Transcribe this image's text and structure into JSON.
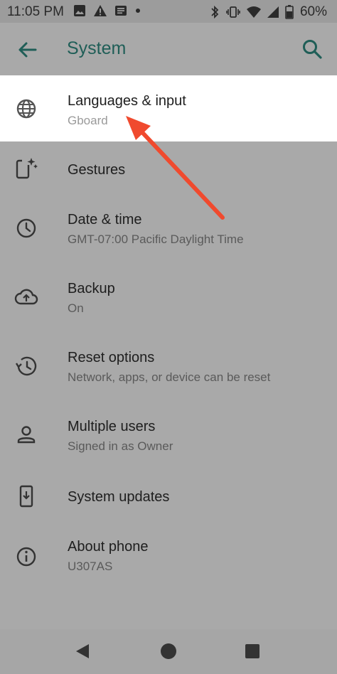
{
  "status_bar": {
    "time": "11:05 PM",
    "battery": "60%"
  },
  "app_bar": {
    "title": "System"
  },
  "items": [
    {
      "title": "Languages & input",
      "subtitle": "Gboard"
    },
    {
      "title": "Gestures",
      "subtitle": ""
    },
    {
      "title": "Date & time",
      "subtitle": "GMT-07:00 Pacific Daylight Time"
    },
    {
      "title": "Backup",
      "subtitle": "On"
    },
    {
      "title": "Reset options",
      "subtitle": "Network, apps, or device can be reset"
    },
    {
      "title": "Multiple users",
      "subtitle": "Signed in as Owner"
    },
    {
      "title": "System updates",
      "subtitle": ""
    },
    {
      "title": "About phone",
      "subtitle": "U307AS"
    }
  ],
  "colors": {
    "accent": "#1f5e57",
    "annotation_arrow": "#f04a2e"
  },
  "icons": [
    "back-arrow-icon",
    "search-icon",
    "globe-icon",
    "gestures-icon",
    "clock-icon",
    "backup-icon",
    "reset-history-icon",
    "person-icon",
    "system-update-icon",
    "info-icon"
  ]
}
